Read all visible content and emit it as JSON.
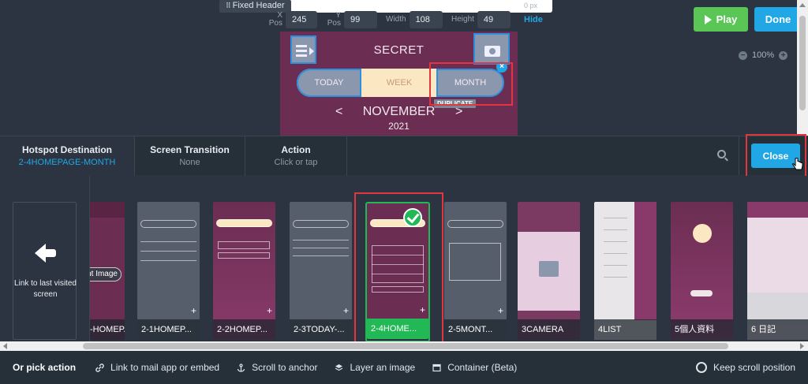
{
  "header": {
    "fixed_header_label": "Fixed Header",
    "ghost_value": "0 px",
    "x_label": "X Pos",
    "x_value": "245",
    "y_label": "Y Pos",
    "y_value": "99",
    "width_label": "Width",
    "width_value": "108",
    "height_label": "Height",
    "height_value": "49",
    "hide_label": "Hide",
    "play_label": "Play",
    "done_label": "Done",
    "zoom_level": "100%"
  },
  "canvas": {
    "title": "SECRET",
    "tab_today": "TODAY",
    "tab_week": "WEEK",
    "tab_month": "MONTH",
    "duplicate_label": "DUPLICATE",
    "month": "NOVEMBER",
    "year": "2021",
    "prev": "<",
    "next": ">"
  },
  "tabs": [
    {
      "title": "Hotspot Destination",
      "sub": "2-4HOMEPAGE-MONTH"
    },
    {
      "title": "Screen Transition",
      "sub": "None"
    },
    {
      "title": "Action",
      "sub": "Click or tap"
    }
  ],
  "close_label": "Close",
  "back_card": {
    "label": "Link to last visited screen"
  },
  "screens": [
    {
      "label": "-HOMEPA...",
      "overlay": "nt Image"
    },
    {
      "label": "2-1HOMEP..."
    },
    {
      "label": "2-2HOMEP..."
    },
    {
      "label": "2-3TODAY-..."
    },
    {
      "label": "2-4HOME..."
    },
    {
      "label": "2-5MONT..."
    },
    {
      "label": "3CAMERA"
    },
    {
      "label": "4LIST"
    },
    {
      "label": "5個人資料"
    },
    {
      "label": "6 日記"
    }
  ],
  "actions": {
    "or_pick": "Or pick action",
    "items": [
      "Link to mail app or embed",
      "Scroll to anchor",
      "Layer an image",
      "Container (Beta)"
    ],
    "keep_scroll": "Keep scroll position"
  },
  "colors": {
    "accent": "#21a7e6",
    "play": "#59c655",
    "selected": "#22b856",
    "highlight": "#e0363f",
    "plum": "#6b2e52"
  }
}
